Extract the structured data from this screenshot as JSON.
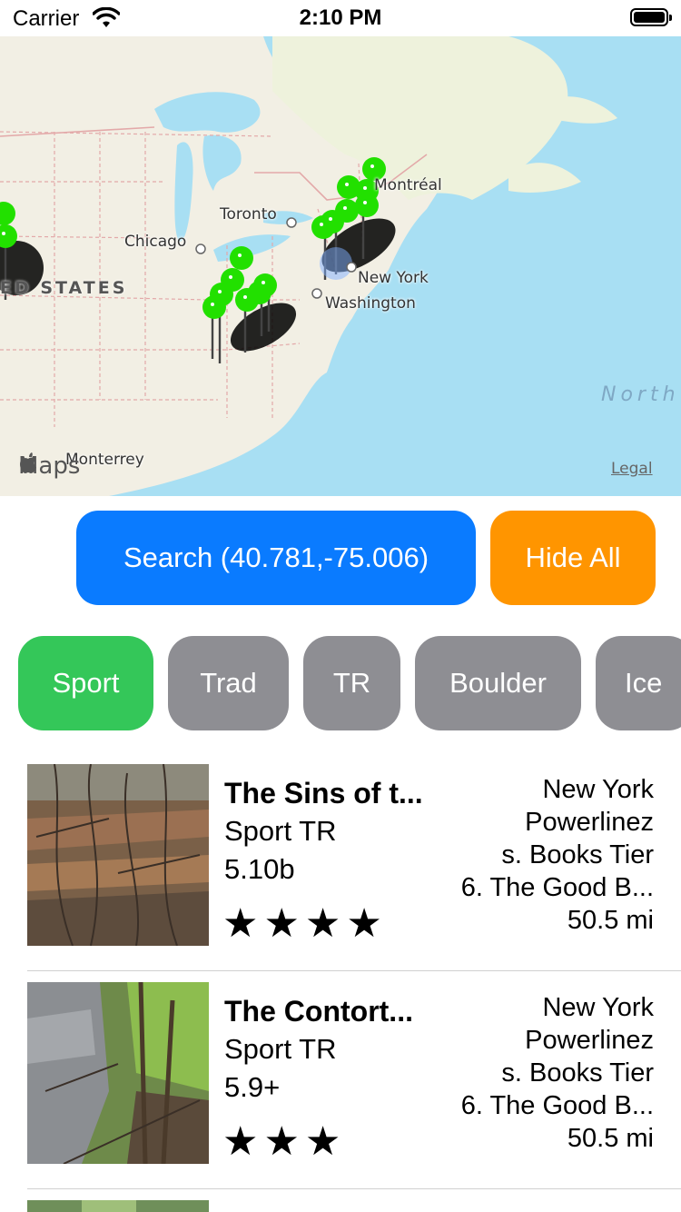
{
  "status_bar": {
    "carrier": "Carrier",
    "time": "2:10 PM"
  },
  "map": {
    "cities": [
      "Toronto",
      "Chicago",
      "Montréal",
      "New York",
      "Washington",
      "Monterrey"
    ],
    "country_label": "ED STATES",
    "ocean_label": "North",
    "logo_text": "Maps",
    "legal": "Legal",
    "pin_color": "#22e000",
    "water_color": "#a8dff3",
    "land_color": "#f2efe4"
  },
  "actions": {
    "search_label": "Search (40.781,-75.006)",
    "hide_label": "Hide All",
    "search_color": "#0a7bff",
    "hide_color": "#ff9500"
  },
  "filters": [
    {
      "label": "Sport",
      "active": true
    },
    {
      "label": "Trad",
      "active": false
    },
    {
      "label": "TR",
      "active": false
    },
    {
      "label": "Boulder",
      "active": false
    },
    {
      "label": "Ice",
      "active": false
    }
  ],
  "routes": [
    {
      "name": "The Sins of t...",
      "types": "Sport  TR",
      "grade": "5.10b",
      "stars": "★★★★",
      "star_count": 4,
      "state": "New York",
      "area": "Powerlinez",
      "sub_area": "s. Books Tier",
      "wall": "6. The Good B...",
      "distance": "50.5 mi"
    },
    {
      "name": "The Contort...",
      "types": "Sport  TR",
      "grade": "5.9+",
      "stars": "★★★",
      "star_count": 3,
      "state": "New York",
      "area": "Powerlinez",
      "sub_area": "s. Books Tier",
      "wall": "6. The Good B...",
      "distance": "50.5 mi"
    }
  ]
}
